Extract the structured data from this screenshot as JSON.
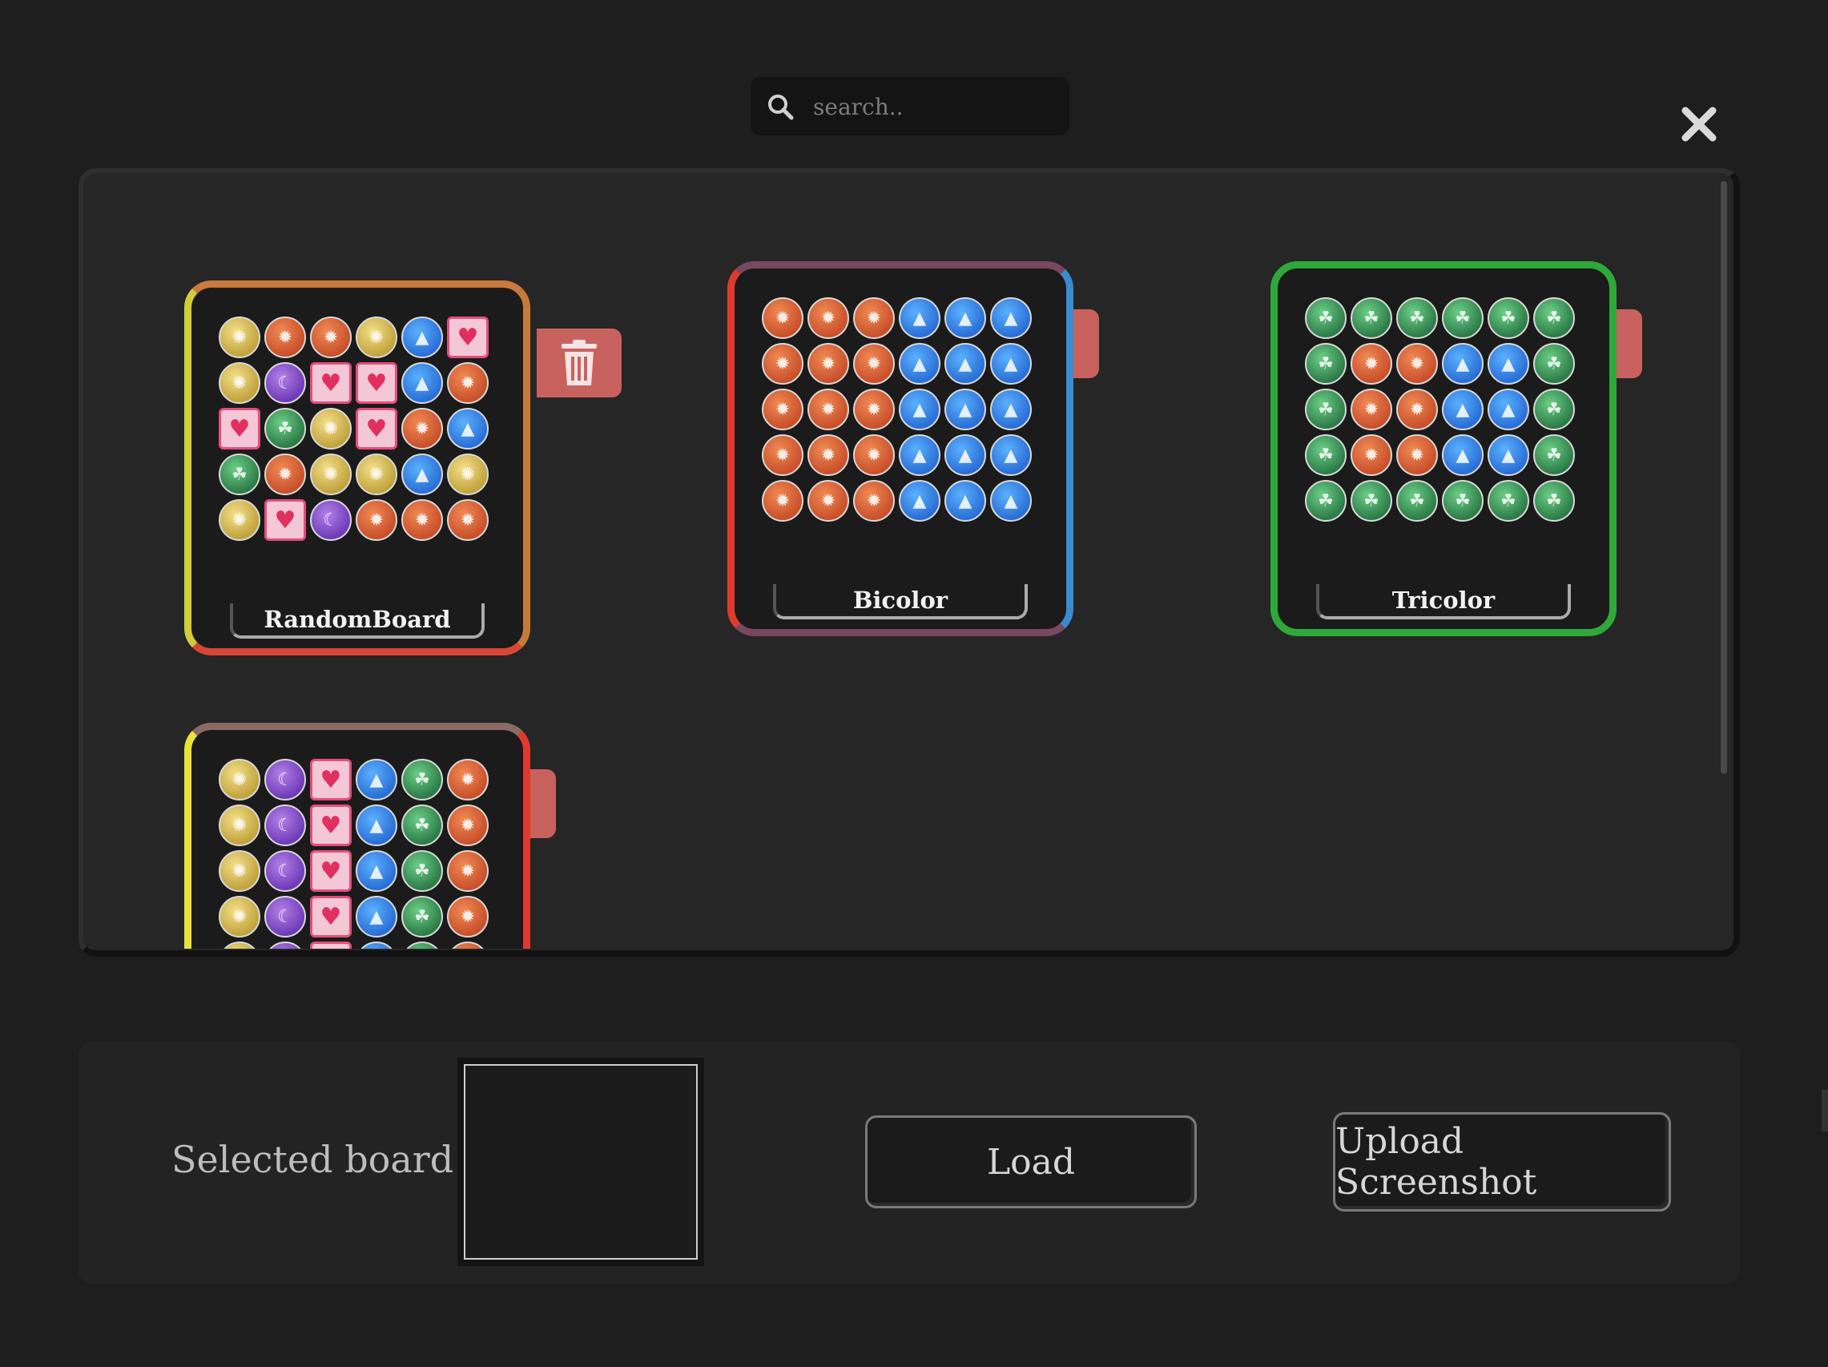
{
  "search": {
    "placeholder": "search.."
  },
  "boards": [
    {
      "name": "RandomBoard",
      "orbs": [
        "y",
        "r",
        "r",
        "y",
        "b",
        "h",
        "y",
        "p",
        "h",
        "h",
        "b",
        "r",
        "h",
        "g",
        "y",
        "h",
        "r",
        "b",
        "g",
        "r",
        "y",
        "y",
        "b",
        "y",
        "y",
        "h",
        "p",
        "r",
        "r",
        "r"
      ]
    },
    {
      "name": "Bicolor",
      "orbs": [
        "r",
        "r",
        "r",
        "b",
        "b",
        "b",
        "r",
        "r",
        "r",
        "b",
        "b",
        "b",
        "r",
        "r",
        "r",
        "b",
        "b",
        "b",
        "r",
        "r",
        "r",
        "b",
        "b",
        "b",
        "r",
        "r",
        "r",
        "b",
        "b",
        "b"
      ]
    },
    {
      "name": "Tricolor",
      "orbs": [
        "g",
        "g",
        "g",
        "g",
        "g",
        "g",
        "g",
        "r",
        "r",
        "b",
        "b",
        "g",
        "g",
        "r",
        "r",
        "b",
        "b",
        "g",
        "g",
        "r",
        "r",
        "b",
        "b",
        "g",
        "g",
        "g",
        "g",
        "g",
        "g",
        "g"
      ]
    },
    {
      "name": "",
      "orbs": [
        "y",
        "p",
        "h",
        "b",
        "g",
        "r",
        "y",
        "p",
        "h",
        "b",
        "g",
        "r",
        "y",
        "p",
        "h",
        "b",
        "g",
        "r",
        "y",
        "p",
        "h",
        "b",
        "g",
        "r",
        "y",
        "p",
        "h",
        "b",
        "g",
        "r"
      ]
    }
  ],
  "selected_label": "Selected board:",
  "buttons": {
    "load": "Load",
    "upload": "Upload Screenshot"
  },
  "colors": {
    "trash": "#c8625e",
    "background": "#1e1e1e"
  },
  "icons": {
    "search": "search-icon",
    "close": "close-icon",
    "trash": "trash-icon"
  }
}
